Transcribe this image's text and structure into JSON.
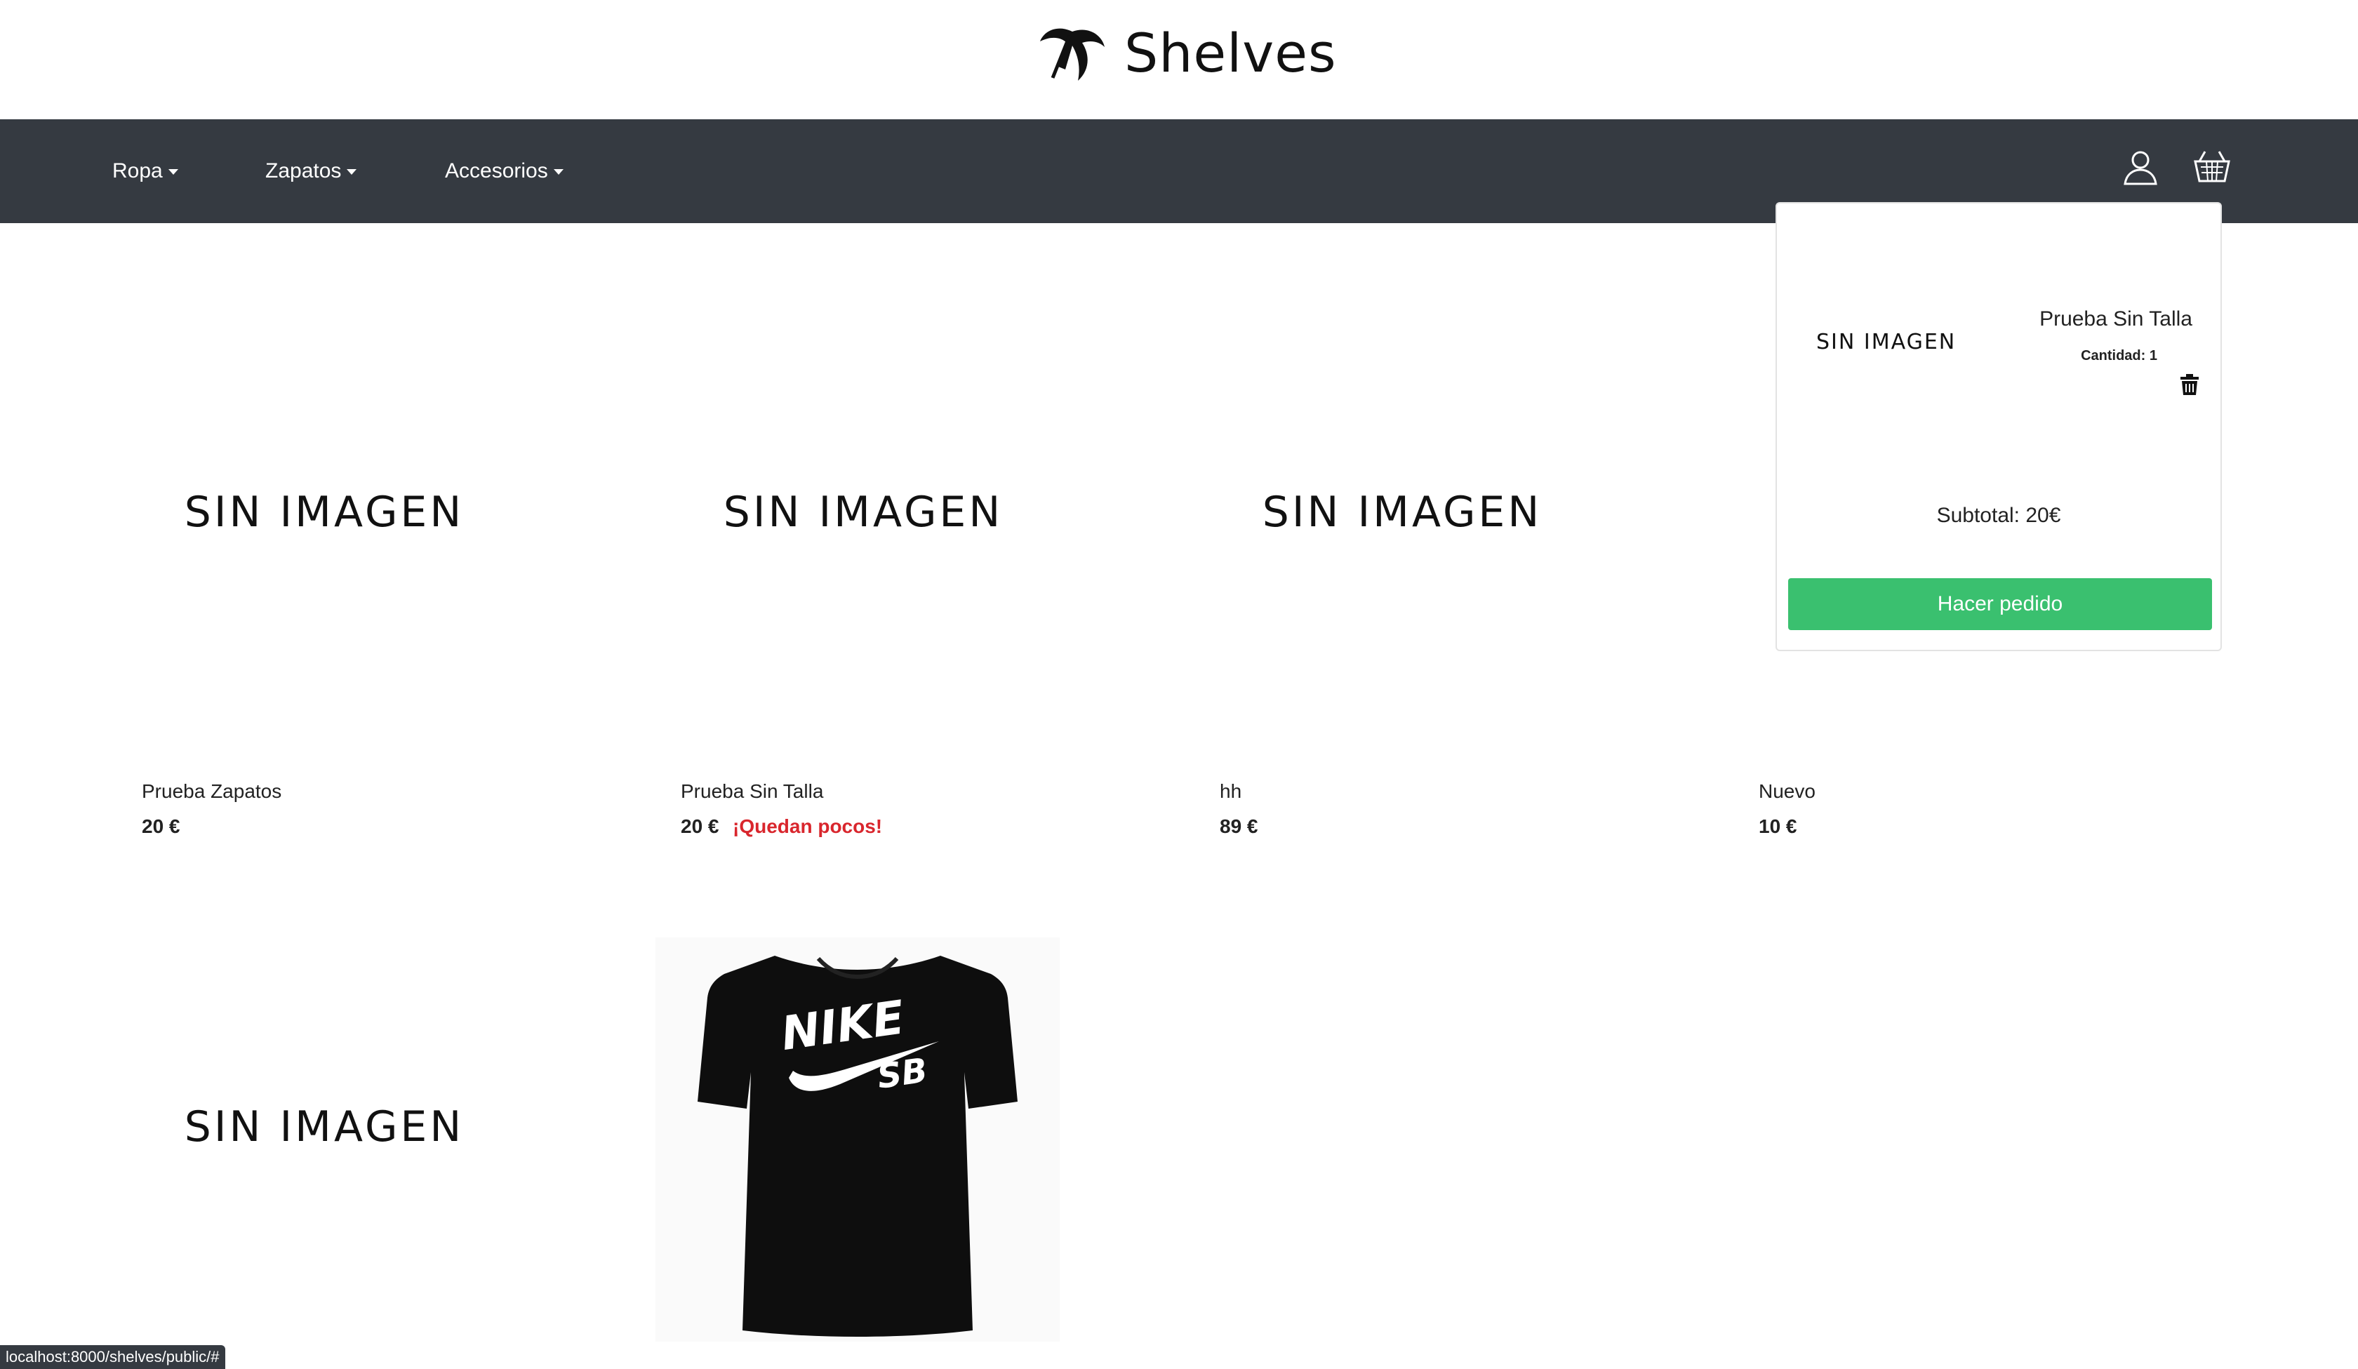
{
  "brand": {
    "name": "Shelves"
  },
  "nav": {
    "items": [
      {
        "label": "Ropa"
      },
      {
        "label": "Zapatos"
      },
      {
        "label": "Accesorios"
      }
    ]
  },
  "products": [
    {
      "name": "Prueba Zapatos",
      "price": "20 €",
      "image_text": "SIN IMAGEN"
    },
    {
      "name": "Prueba Sin Talla",
      "price": "20 €",
      "badge": "¡Quedan pocos!",
      "image_text": "SIN IMAGEN"
    },
    {
      "name": "hh",
      "price": "89 €",
      "image_text": "SIN IMAGEN"
    },
    {
      "name": "Nuevo",
      "price": "10 €"
    }
  ],
  "row2": [
    {
      "image_text": "SIN IMAGEN"
    },
    {
      "image": "Nike SB black t-shirt",
      "logo_text": "NIKE",
      "logo_sub": "SB"
    }
  ],
  "cart": {
    "item_image_text": "SIN IMAGEN",
    "item_name": "Prueba Sin Talla",
    "quantity": "Cantidad: 1",
    "subtotal": "Subtotal: 20€",
    "checkout_label": "Hacer pedido",
    "accent": "#3ac06f"
  },
  "status": {
    "url": "localhost:8000/shelves/public/#"
  },
  "colors": {
    "navbar": "#353a41",
    "warning": "#d9262d"
  }
}
